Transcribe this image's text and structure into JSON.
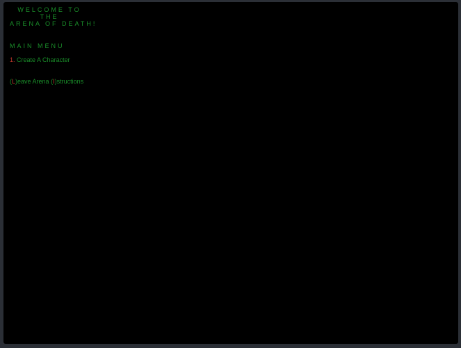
{
  "welcome": {
    "line1": "WELCOME TO",
    "line2": "THE",
    "line3": "ARENA OF DEATH!"
  },
  "main_menu": {
    "title": "MAIN MENU",
    "create": {
      "key": "1.",
      "label": "Create A Character"
    },
    "leave": {
      "open": "(",
      "key": "L",
      "close": ")",
      "label": "eave Arena"
    },
    "instructions": {
      "open": "(",
      "key": "I",
      "close": ")",
      "label": "structions"
    }
  },
  "colors": {
    "text": "#1a8f2a",
    "hotkey": "#c0392b",
    "background": "#000000",
    "frame": "#2b2f36"
  }
}
